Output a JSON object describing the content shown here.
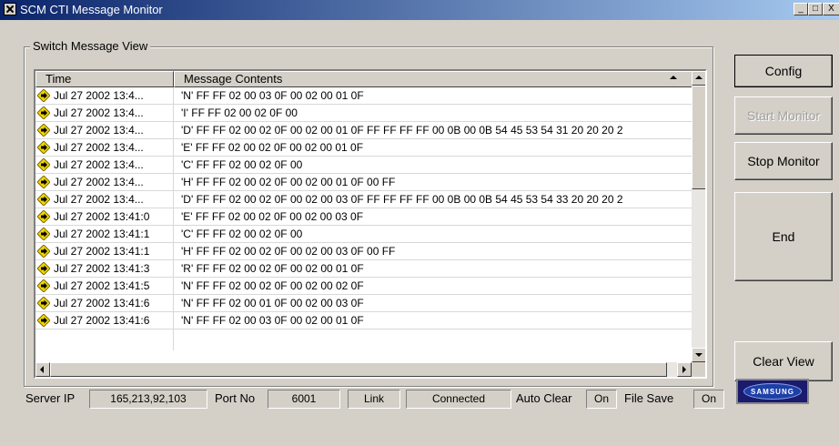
{
  "window": {
    "title": "SCM CTI Message Monitor",
    "minimize_glyph": "_",
    "maximize_glyph": "□",
    "close_glyph": "X"
  },
  "group": {
    "label": "Switch Message View"
  },
  "listview": {
    "columns": [
      "Time",
      "Message Contents"
    ],
    "row_icon": "diamond-arrow-icon",
    "rows": [
      {
        "time": "Jul 27 2002 13:4...",
        "msg": "'N' FF FF 02 00 03 0F 00 02 00 01 0F"
      },
      {
        "time": "Jul 27 2002 13:4...",
        "msg": "'I' FF FF 02 00 02 0F 00"
      },
      {
        "time": "Jul 27 2002 13:4...",
        "msg": "'D' FF FF 02 00 02 0F 00 02 00 01 0F FF FF FF FF 00 0B 00 0B 54 45 53 54 31 20 20 20 2"
      },
      {
        "time": "Jul 27 2002 13:4...",
        "msg": "'E' FF FF 02 00 02 0F 00 02 00 01 0F"
      },
      {
        "time": "Jul 27 2002 13:4...",
        "msg": "'C' FF FF 02 00 02 0F 00"
      },
      {
        "time": "Jul 27 2002 13:4...",
        "msg": "'H' FF FF 02 00 02 0F 00 02 00 01 0F 00 FF"
      },
      {
        "time": "Jul 27 2002 13:4...",
        "msg": "'D' FF FF 02 00 02 0F 00 02 00 03 0F FF FF FF FF 00 0B 00 0B 54 45 53 54 33 20 20 20 2"
      },
      {
        "time": "Jul 27 2002 13:41:0",
        "msg": "'E' FF FF 02 00 02 0F 00 02 00 03 0F"
      },
      {
        "time": "Jul 27 2002 13:41:1",
        "msg": "'C' FF FF 02 00 02 0F 00"
      },
      {
        "time": "Jul 27 2002 13:41:1",
        "msg": "'H' FF FF 02 00 02 0F 00 02 00 03 0F 00 FF"
      },
      {
        "time": "Jul 27 2002 13:41:3",
        "msg": "'R' FF FF 02 00 02 0F 00 02 00 01 0F"
      },
      {
        "time": "Jul 27 2002 13:41:5",
        "msg": "'N' FF FF 02 00 02 0F 00 02 00 02 0F"
      },
      {
        "time": "Jul 27 2002 13:41:6",
        "msg": "'N' FF FF 02 00 01 0F 00 02 00 03 0F"
      },
      {
        "time": "Jul 27 2002 13:41:6",
        "msg": "'N' FF FF 02 00 03 0F 00 02 00 01 0F"
      }
    ]
  },
  "buttons": {
    "config": "Config",
    "start_monitor": "Start Monitor",
    "stop_monitor": "Stop Monitor",
    "end": "End",
    "clear_view": "Clear View"
  },
  "status": {
    "server_ip_label": "Server IP",
    "server_ip_value": "165,213,92,103",
    "port_label": "Port No",
    "port_value": "6001",
    "link_label": "Link",
    "link_value": "Connected",
    "auto_clear_label": "Auto Clear",
    "auto_clear_value": "On",
    "file_save_label": "File Save",
    "file_save_value": "On"
  },
  "logo": {
    "text": "SAMSUNG"
  },
  "colors": {
    "titlebar_start": "#0a246a",
    "titlebar_end": "#a6caf0",
    "face": "#d4d0c8",
    "icon_yellow": "#f5d800",
    "logo_blue": "#1d3fa8"
  }
}
